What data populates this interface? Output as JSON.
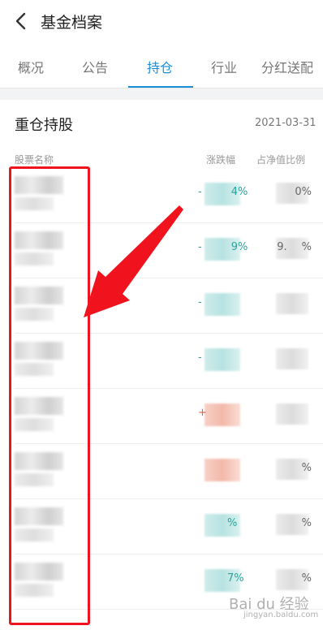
{
  "header": {
    "title": "基金档案",
    "back_icon": "chevron-left-icon"
  },
  "tabs": [
    {
      "label": "概况",
      "active": false
    },
    {
      "label": "公告",
      "active": false
    },
    {
      "label": "持仓",
      "active": true
    },
    {
      "label": "行业",
      "active": false
    },
    {
      "label": "分红送配",
      "active": false
    }
  ],
  "section": {
    "title": "重仓持股",
    "date": "2021-03-31"
  },
  "columns": {
    "name": "股票名称",
    "change": "涨跌幅",
    "ratio": "占净值比例"
  },
  "rows": [
    {
      "change_prefix": "-",
      "change_suffix": "4%",
      "ratio_suffix": "0%",
      "direction": "down"
    },
    {
      "change_prefix": "-",
      "change_suffix": "9%",
      "ratio_prefix": "9.",
      "ratio_suffix": "%",
      "direction": "down"
    },
    {
      "change_prefix": "-",
      "change_suffix": "",
      "ratio_suffix": "",
      "direction": "down"
    },
    {
      "change_prefix": "-",
      "change_suffix": "",
      "ratio_suffix": "",
      "direction": "down"
    },
    {
      "change_prefix": "+",
      "change_suffix": "",
      "ratio_suffix": "",
      "direction": "up"
    },
    {
      "change_prefix": "",
      "change_suffix": "",
      "ratio_suffix": "%",
      "direction": "up"
    },
    {
      "change_prefix": "",
      "change_suffix": "%",
      "ratio_suffix": "%",
      "direction": "down"
    },
    {
      "change_prefix": "",
      "change_suffix": "7%",
      "ratio_suffix": "%",
      "direction": "down"
    }
  ],
  "watermark": {
    "text": "Bai du 经验",
    "sub": "jingyan.baidu.com"
  },
  "colors": {
    "accent": "#1a8fd8",
    "down": "#2ba39b",
    "up": "#e05c45",
    "highlight": "#f0131e"
  }
}
